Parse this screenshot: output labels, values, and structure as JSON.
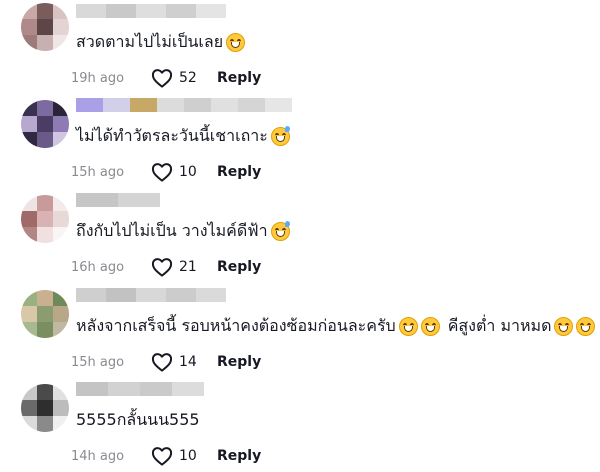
{
  "icons": {
    "like": "heart-outline-icon",
    "emoji_grin": "grinning-squinting-face-icon",
    "emoji_sweat": "grinning-face-with-sweat-icon"
  },
  "colors": {
    "text": "#161823",
    "secondary": "#8a8b91",
    "emoji": "#ffc83d"
  },
  "comments": [
    {
      "text": "สวดตามไปไม่เป็นเลย",
      "emojis": [
        "grin"
      ],
      "time": "19h ago",
      "likes": "52",
      "reply": "Reply",
      "avatar": [
        "#c9a8a8",
        "#7a5c5c",
        "#d8c2c2",
        "#b08a8a",
        "#5e4646",
        "#e4d3d3",
        "#9c7b7b",
        "#c7b0b0",
        "#f0e6e6"
      ],
      "name_blocks": [
        "#d9d9d9",
        "#c9c9c9",
        "#dedede",
        "#cfcfcf",
        "#e4e4e4"
      ]
    },
    {
      "text": "ไม่ได้ทำวัตรละวันนี้เชาเถาะ",
      "emojis": [
        "sweat"
      ],
      "time": "15h ago",
      "likes": "10",
      "reply": "Reply",
      "avatar": [
        "#3a3050",
        "#7c6aa0",
        "#2a2438",
        "#b7a8d0",
        "#4a3d64",
        "#8e7bb4",
        "#2e2840",
        "#6a5a88",
        "#d0c6e0"
      ],
      "name_blocks": [
        "#a9a0e8",
        "#d2cfe8",
        "#c8a866",
        "#dcdcdc",
        "#cfcfcf",
        "#e0e0e0",
        "#d5d5d5",
        "#e6e6e6"
      ]
    },
    {
      "text": "ถึงกับไปไม่เป็น วางไมค์ดีฟ้า",
      "emojis": [
        "sweat"
      ],
      "time": "16h ago",
      "likes": "21",
      "reply": "Reply",
      "avatar": [
        "#efe4e4",
        "#c89a9a",
        "#f4eaea",
        "#a06a6a",
        "#d9b3b3",
        "#e8d8d8",
        "#b38686",
        "#f0e0e0",
        "#fbf4f4"
      ],
      "name_blocks": [
        "#c6c6c6",
        "#d4d4d4"
      ]
    },
    {
      "text": "หลังจากเสร็จนี้ รอบหน้าคงต้องซ้อมก่อนละครับ",
      "emojis": [
        "grin",
        "grin"
      ],
      "text2": "คีสูงต่ำ มาหมด",
      "emojis2": [
        "grin",
        "grin"
      ],
      "time": "15h ago",
      "likes": "14",
      "reply": "Reply",
      "avatar": [
        "#9ab080",
        "#c8b090",
        "#6f8a5a",
        "#d8c8a8",
        "#8a9c70",
        "#b8a888",
        "#a8b890",
        "#7a8e62",
        "#c0b8a0"
      ],
      "name_blocks": [
        "#cfcfcf",
        "#c2c2c2",
        "#d8d8d8",
        "#cccccc",
        "#dadada"
      ]
    },
    {
      "text": "5555กลั้นนน555",
      "emojis": [],
      "time": "14h ago",
      "likes": "10",
      "reply": "Reply",
      "avatar": [
        "#c8c8c8",
        "#4a4a4a",
        "#e0e0e0",
        "#6a6a6a",
        "#2e2e2e",
        "#bcbcbc",
        "#dadada",
        "#8a8a8a",
        "#f0f0f0"
      ],
      "name_blocks": [
        "#c4c4c4",
        "#d2d2d2",
        "#cacaca",
        "#dcdcdc"
      ]
    }
  ]
}
